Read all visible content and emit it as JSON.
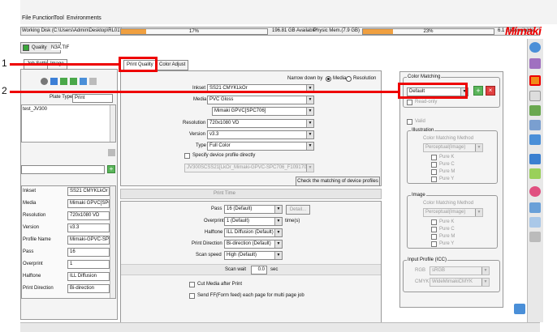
{
  "menu": [
    "File",
    "Function",
    "Tool",
    "Environments"
  ],
  "disk": {
    "label": "Working Disk (C:\\Users\\Admin\\Desktop\\RL01\\)",
    "used_pct": "17%",
    "available": "196.81 GB Available",
    "mem_label": "Physic Mem.(7.9 GB)",
    "mem_pct": "23%",
    "mem_available": "6.1 GB Available",
    "disk_fill": 0.17,
    "mem_fill": 0.23
  },
  "logo": "Mimaki",
  "job_tabs": [
    "Quality",
    "N3A.TIF"
  ],
  "left_tabs": [
    "Job Setting",
    "Image"
  ],
  "plate_type_label": "Plate Type",
  "plate_type_value": "Print",
  "job_list": [
    "test_JV300"
  ],
  "props": [
    {
      "k": "Inkset",
      "v": "SS21 CMYKLkOr"
    },
    {
      "k": "Media",
      "v": "Mimaki GPVC[SPC7"
    },
    {
      "k": "Resolution",
      "v": "720x1080 VD"
    },
    {
      "k": "Version",
      "v": "v3.3"
    },
    {
      "k": "Profile Name",
      "v": "Mimaki-GPVC-SPC7"
    },
    {
      "k": "Pass",
      "v": "16"
    },
    {
      "k": "Overprint",
      "v": "1"
    },
    {
      "k": "Halftone",
      "v": "ILL Diffusion"
    },
    {
      "k": "Print Direction",
      "v": "Bi-direction"
    }
  ],
  "main_tabs": [
    "Print Quality",
    "Color Adjust"
  ],
  "narrow": {
    "label": "Narrow down by",
    "opt1": "Media",
    "opt2": "Resolution"
  },
  "pq": {
    "inkset_label": "Inkset",
    "inkset": "SS21 CMYKLkOr",
    "media_label": "Media",
    "media": "PVC Gloss",
    "media2": "Mimaki GPVC[SPC706]",
    "resolution_label": "Resolution",
    "resolution": "720x1080 VD",
    "version_label": "Version",
    "version": "v3.3",
    "type_label": "Type",
    "type": "Full Color",
    "specify_label": "Specify device profile directly",
    "profile_path": "JV300SCSS21[LkOr_Mimaki-GPVC-SPC706_F109170.icc",
    "check_btn": "Check the matching of device profiles"
  },
  "print_time": "Print Time",
  "pt": {
    "pass_label": "Pass",
    "pass": "16 (Default)",
    "detail": "Detail...",
    "overprint_label": "Overprint",
    "overprint": "1 (Default)",
    "times": "time(s)",
    "halftone_label": "Halftone",
    "halftone": "ILL Diffusion (Default)",
    "direction_label": "Print Direction",
    "direction": "Bi-direction (Default)",
    "speed_label": "Scan speed",
    "speed": "High (Default)",
    "wait_label": "Scan wait",
    "wait": "0.0",
    "sec": "sec",
    "cut_label": "Cut Media after Print",
    "feed_label": "Send FF(Form feed) each page for multi page job"
  },
  "cm": {
    "title": "Color Matching",
    "value": "Default",
    "readonly": "Read-only",
    "valid": "Valid",
    "illus": "Illustration",
    "method_label": "Color Matching Method",
    "method": "Perceptual(Image)",
    "pure": [
      "Pure K",
      "Pure C",
      "Pure M",
      "Pure Y"
    ],
    "image": "Image",
    "icc": "Input Profile (ICC)",
    "rgb_label": "RGB",
    "rgb": "sRGB",
    "cmyk_label": "CMYK",
    "cmyk": "WideMimakiCMYK"
  },
  "callouts": [
    "1",
    "2"
  ],
  "colors": {
    "accent": "#e00000",
    "progress": "#f0a040",
    "green": "#3aa63a"
  }
}
